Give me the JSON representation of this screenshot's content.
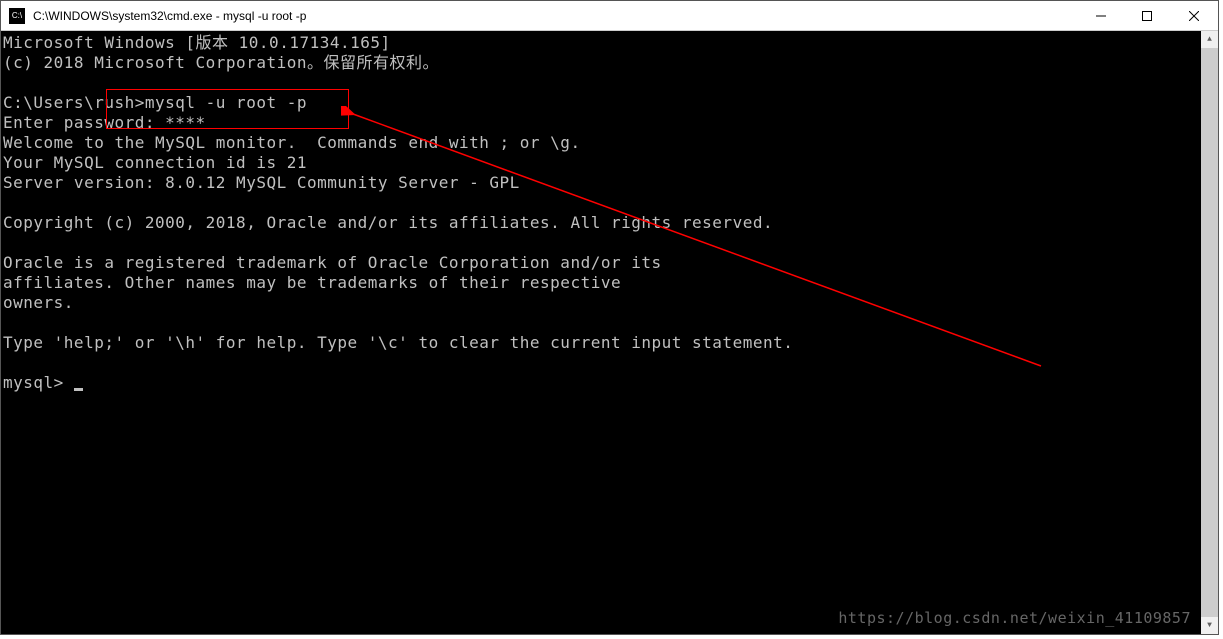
{
  "window": {
    "title": "C:\\WINDOWS\\system32\\cmd.exe - mysql  -u root -p",
    "icon_label": "C:\\"
  },
  "terminal": {
    "line1": "Microsoft Windows [版本 10.0.17134.165]",
    "line2": "(c) 2018 Microsoft Corporation。保留所有权利。",
    "line3": "",
    "prompt_path": "C:\\Users\\rush>",
    "command": "mysql -u root -p",
    "password_line": "Enter password: ****",
    "welcome1": "Welcome to the MySQL monitor.  Commands end with ; or \\g.",
    "welcome2": "Your MySQL connection id is 21",
    "welcome3": "Server version: 8.0.12 MySQL Community Server - GPL",
    "copyright": "Copyright (c) 2000, 2018, Oracle and/or its affiliates. All rights reserved.",
    "trademark1": "Oracle is a registered trademark of Oracle Corporation and/or its",
    "trademark2": "affiliates. Other names may be trademarks of their respective",
    "trademark3": "owners.",
    "help_line": "Type 'help;' or '\\h' for help. Type '\\c' to clear the current input statement.",
    "mysql_prompt": "mysql> "
  },
  "watermark": "https://blog.csdn.net/weixin_41109857"
}
